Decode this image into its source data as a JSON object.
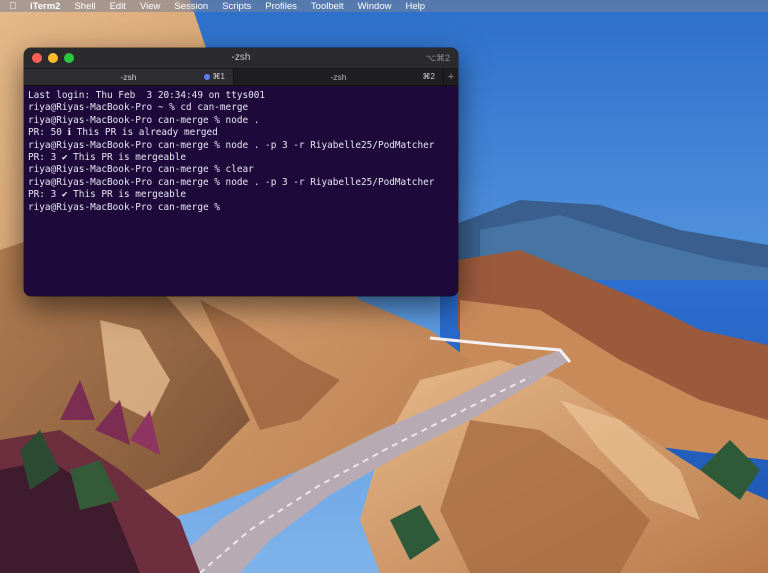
{
  "menubar": {
    "apple_icon": "apple-logo-icon",
    "items": [
      "iTerm2",
      "Shell",
      "Edit",
      "View",
      "Session",
      "Scripts",
      "Profiles",
      "Toolbelt",
      "Window",
      "Help"
    ]
  },
  "window": {
    "title": "-zsh",
    "shortcut": "⌥⌘2",
    "tabs": [
      {
        "label": "-zsh",
        "shortcut": "⌘1",
        "active": true,
        "indicator_color": "#5b7cff"
      },
      {
        "label": "-zsh",
        "shortcut": "⌘2",
        "active": false
      }
    ],
    "add_tab_label": "+"
  },
  "terminal": {
    "lines": [
      "Last login: Thu Feb  3 20:34:49 on ttys001",
      "riya@Riyas-MacBook-Pro ~ % cd can-merge",
      "riya@Riyas-MacBook-Pro can-merge % node .",
      "PR: 50 ℹ This PR is already merged",
      "riya@Riyas-MacBook-Pro can-merge % node . -p 3 -r Riyabelle25/PodMatcher",
      "PR: 3 ✔ This PR is mergeable",
      "riya@Riyas-MacBook-Pro can-merge % clear",
      "riya@Riyas-MacBook-Pro can-merge % node . -p 3 -r Riyabelle25/PodMatcher",
      "PR: 3 ✔ This PR is mergeable",
      "riya@Riyas-MacBook-Pro can-merge %"
    ],
    "background_color": "#1d0a3a",
    "text_color": "#e9e6f5"
  },
  "colors": {
    "traffic_close": "#fe5f57",
    "traffic_min": "#febc2e",
    "traffic_max": "#28c840"
  }
}
